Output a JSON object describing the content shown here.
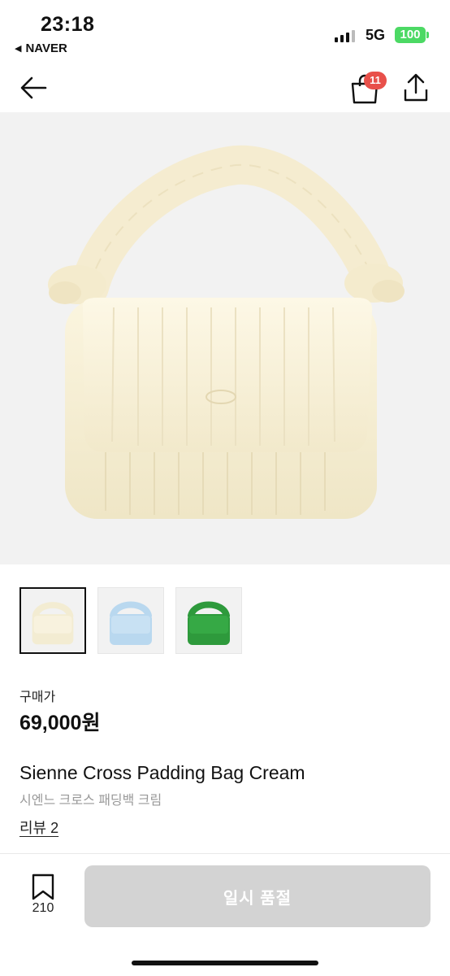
{
  "status_bar": {
    "time": "23:18",
    "back_app": "NAVER",
    "network": "5G",
    "battery": "100"
  },
  "nav": {
    "cart_count": "11",
    "icons": [
      "back-arrow-icon",
      "shopping-bag-icon",
      "share-icon"
    ]
  },
  "product": {
    "price_label": "구매가",
    "price": "69,000원",
    "name_en": "Sienne Cross Padding Bag Cream",
    "name_ko": "시엔느 크로스 패딩백 크림",
    "review_link": "리뷰 2",
    "thumbnails": [
      {
        "color": "#f3ecd2",
        "selected": true
      },
      {
        "color": "#b9d8ef",
        "selected": false
      },
      {
        "color": "#2e9a3c",
        "selected": false
      }
    ]
  },
  "bottom_bar": {
    "bookmark_count": "210",
    "buy_button": "일시 품절"
  },
  "colors": {
    "badge": "#e8504a",
    "battery": "#4cd964",
    "disabled_button": "#d3d3d3",
    "image_bg": "#f2f2f2"
  }
}
